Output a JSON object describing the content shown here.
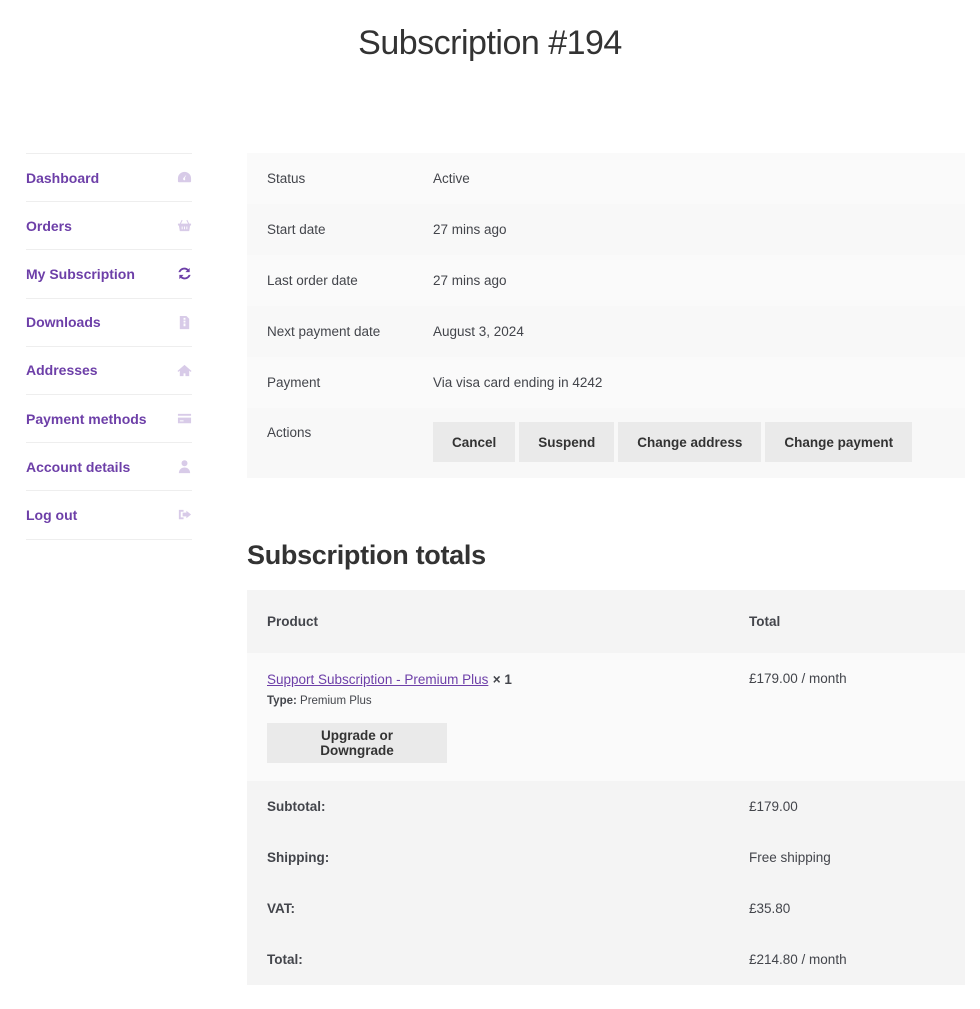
{
  "page": {
    "title": "Subscription #194"
  },
  "nav": {
    "items": [
      {
        "label": "Dashboard",
        "icon": "dashboard-icon",
        "active": false
      },
      {
        "label": "Orders",
        "icon": "basket-icon",
        "active": false
      },
      {
        "label": "My Subscription",
        "icon": "refresh-icon",
        "active": true
      },
      {
        "label": "Downloads",
        "icon": "file-icon",
        "active": false
      },
      {
        "label": "Addresses",
        "icon": "home-icon",
        "active": false
      },
      {
        "label": "Payment methods",
        "icon": "credit-card-icon",
        "active": false
      },
      {
        "label": "Account details",
        "icon": "user-icon",
        "active": false
      },
      {
        "label": "Log out",
        "icon": "logout-icon",
        "active": false
      }
    ]
  },
  "details": {
    "rows": [
      {
        "label": "Status",
        "value": "Active"
      },
      {
        "label": "Start date",
        "value": "27 mins ago"
      },
      {
        "label": "Last order date",
        "value": "27 mins ago"
      },
      {
        "label": "Next payment date",
        "value": "August 3, 2024"
      },
      {
        "label": "Payment",
        "value": "Via visa card ending in 4242"
      }
    ],
    "actions_label": "Actions",
    "actions": [
      "Cancel",
      "Suspend",
      "Change address",
      "Change payment"
    ]
  },
  "totals": {
    "heading": "Subscription totals",
    "columns": {
      "product": "Product",
      "total": "Total"
    },
    "item": {
      "name": "Support Subscription - Premium Plus",
      "quantity": "× 1",
      "meta_label": "Type:",
      "meta_value": "Premium Plus",
      "upgrade_label": "Upgrade or Downgrade",
      "total": "£179.00 / month"
    },
    "footer": [
      {
        "label": "Subtotal:",
        "value": "£179.00"
      },
      {
        "label": "Shipping:",
        "value": "Free shipping"
      },
      {
        "label": "VAT:",
        "value": "£35.80"
      },
      {
        "label": "Total:",
        "value": "£214.80 / month"
      }
    ]
  },
  "colors": {
    "accent": "#6d3fa8",
    "icon_muted": "#d8cbe8",
    "button_bg": "#eaeaea"
  }
}
